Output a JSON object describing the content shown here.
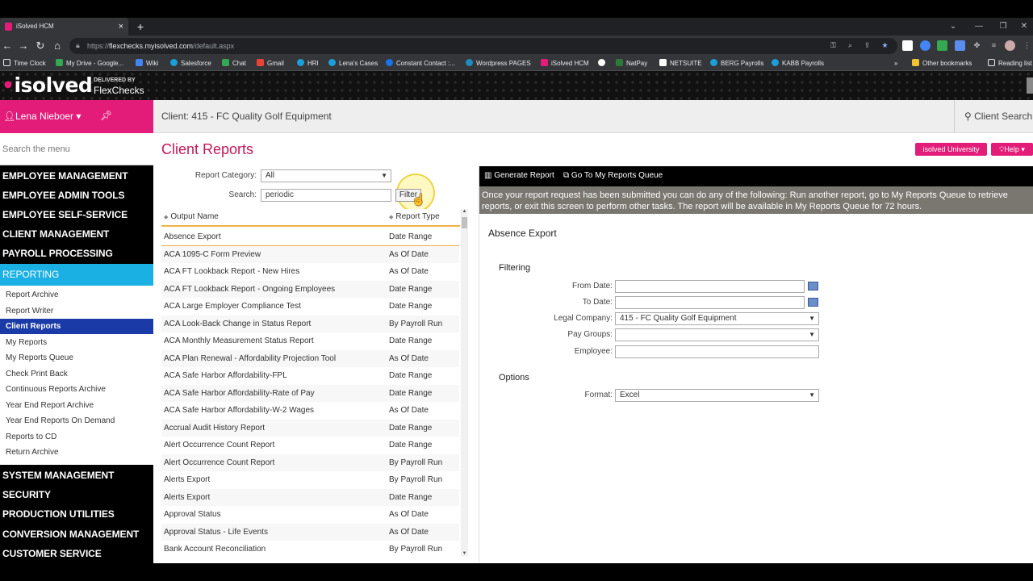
{
  "browser": {
    "tab_title": "iSolved HCM",
    "url_prefix": "https://",
    "url_host": "flexchecks.myisolved.com",
    "url_path": "/default.aspx",
    "bookmarks": [
      "Time Clock",
      "My Drive - Google...",
      "Wiki",
      "Salesforce",
      "Chat",
      "Gmail",
      "HRI",
      "Lena's Cases",
      "Constant Contact :...",
      "Wordpress PAGES",
      "iSolved HCM",
      "",
      "NatPay",
      "NETSUITE",
      "BERG Payrolls",
      "KABB Payrolls"
    ],
    "bookmark_colors": [
      "#e8eaed",
      "#34a853",
      "#4285f4",
      "#1a9fd9",
      "#34a853",
      "#ea4335",
      "#1a9fd9",
      "#1a9fd9",
      "#1a73e8",
      "#1e8cbe",
      "#e31c79",
      "#ea4335",
      "#2b7a3a",
      "#ffffff",
      "#1a9fd9",
      "#1a9fd9"
    ],
    "overflow": "»",
    "other_bookmarks": "Other bookmarks",
    "reading_list": "Reading list"
  },
  "banner": {
    "logo_text": "isolved",
    "delivered_by": "DELIVERED BY",
    "brand": "FlexChecks"
  },
  "user": {
    "name": "Lena Nieboer ▾"
  },
  "client": {
    "title": "Client: 415 - FC Quality Golf Equipment",
    "search": "Client Search"
  },
  "sidebar": {
    "search_placeholder": "Search the menu",
    "top_sections": [
      "EMPLOYEE MANAGEMENT",
      "EMPLOYEE ADMIN TOOLS",
      "EMPLOYEE SELF-SERVICE",
      "CLIENT MANAGEMENT",
      "PAYROLL PROCESSING"
    ],
    "active_section": "REPORTING",
    "sub_items": [
      "Report Archive",
      "Report Writer",
      "Client Reports",
      "My Reports",
      "My Reports Queue",
      "Check Print Back",
      "Continuous Reports Archive",
      "Year End Report Archive",
      "Year End Reports On Demand",
      "Reports to CD",
      "Return Archive"
    ],
    "active_sub": "Client Reports",
    "bottom_sections": [
      "SYSTEM MANAGEMENT",
      "SECURITY",
      "PRODUCTION UTILITIES",
      "CONVERSION MANAGEMENT",
      "CUSTOMER SERVICE"
    ]
  },
  "content": {
    "title": "Client Reports",
    "university_btn": "isolved University",
    "help_btn": "Help ▾",
    "report_category_label": "Report Category:",
    "report_category_value": "All",
    "search_label": "Search:",
    "search_value": "periodic",
    "filter_btn": "Filter",
    "col_output_name": "Output Name",
    "col_report_type": "Report Type",
    "rows": [
      {
        "name": "Absence Export",
        "type": "Date Range"
      },
      {
        "name": "ACA 1095-C Form Preview",
        "type": "As Of Date"
      },
      {
        "name": "ACA FT Lookback Report - New Hires",
        "type": "As Of Date"
      },
      {
        "name": "ACA FT Lookback Report - Ongoing Employees",
        "type": "Date Range"
      },
      {
        "name": "ACA Large Employer Compliance Test",
        "type": "Date Range"
      },
      {
        "name": "ACA Look-Back Change in Status Report",
        "type": "By Payroll Run"
      },
      {
        "name": "ACA Monthly Measurement Status Report",
        "type": "Date Range"
      },
      {
        "name": "ACA Plan Renewal - Affordability Projection Tool",
        "type": "As Of Date"
      },
      {
        "name": "ACA Safe Harbor Affordability-FPL",
        "type": "Date Range"
      },
      {
        "name": "ACA Safe Harbor Affordability-Rate of Pay",
        "type": "Date Range"
      },
      {
        "name": "ACA Safe Harbor Affordability-W-2 Wages",
        "type": "As Of Date"
      },
      {
        "name": "Accrual Audit History Report",
        "type": "Date Range"
      },
      {
        "name": "Alert Occurrence Count Report",
        "type": "Date Range"
      },
      {
        "name": "Alert Occurrence Count Report",
        "type": "By Payroll Run"
      },
      {
        "name": "Alerts Export",
        "type": "By Payroll Run"
      },
      {
        "name": "Alerts Export",
        "type": "Date Range"
      },
      {
        "name": "Approval Status",
        "type": "As Of Date"
      },
      {
        "name": "Approval Status - Life Events",
        "type": "As Of Date"
      },
      {
        "name": "Bank Account Reconciliation",
        "type": "By Payroll Run"
      }
    ]
  },
  "panel": {
    "generate_btn": "Generate Report",
    "queue_btn": "Go To My Reports Queue",
    "note": "Once your report request has been submitted you can do any of the following: Run another report, go to My Reports Queue to retrieve reports, or exit this screen to perform other tasks. The report will be available in My Reports Queue for 72 hours.",
    "report_name": "Absence Export",
    "filtering_heading": "Filtering",
    "from_date_label": "From Date:",
    "to_date_label": "To Date:",
    "legal_company_label": "Legal Company:",
    "legal_company_value": "415 - FC Quality Golf Equipment",
    "pay_groups_label": "Pay Groups:",
    "employee_label": "Employee:",
    "options_heading": "Options",
    "format_label": "Format:",
    "format_value": "Excel"
  },
  "colors": {
    "brand_pink": "#e31c79",
    "active_blue": "#1ab0e3",
    "selected_sub": "#1a3aa8",
    "row_accent": "#f0b24a"
  }
}
